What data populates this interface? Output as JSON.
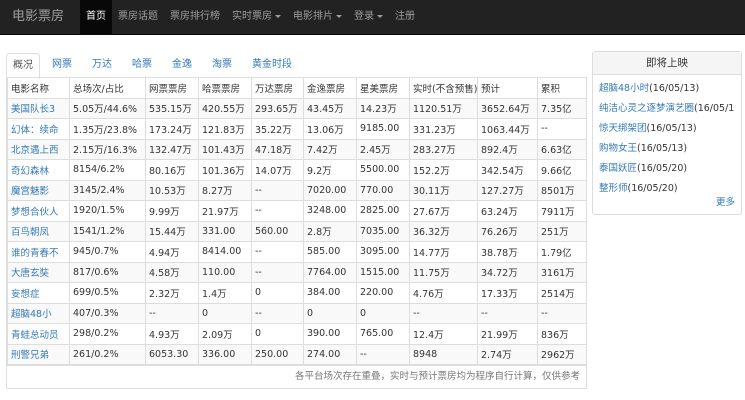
{
  "brand": "电影票房",
  "nav": [
    {
      "label": "首页",
      "active": true,
      "dropdown": false
    },
    {
      "label": "票房话题",
      "active": false,
      "dropdown": false
    },
    {
      "label": "票房排行榜",
      "active": false,
      "dropdown": false
    },
    {
      "label": "实时票房",
      "active": false,
      "dropdown": true
    },
    {
      "label": "电影排片",
      "active": false,
      "dropdown": true
    },
    {
      "label": "登录",
      "active": false,
      "dropdown": true
    },
    {
      "label": "注册",
      "active": false,
      "dropdown": false
    }
  ],
  "tabs": [
    "概况",
    "网票",
    "万达",
    "哈票",
    "金逸",
    "淘票",
    "黄金时段"
  ],
  "table": {
    "headers": [
      "电影名称",
      "总场次/占比",
      "网票票房",
      "哈票票房",
      "万达票房",
      "金逸票房",
      "星美票房",
      "实时(不含预售)",
      "预计",
      "累积"
    ],
    "rows": [
      [
        "美国队长3",
        "5.05万/44.6%",
        "535.15万",
        "420.55万",
        "293.65万",
        "43.45万",
        "14.23万",
        "1120.51万",
        "3652.64万",
        "7.35亿"
      ],
      [
        "幻体：续命",
        "1.35万/23.8%",
        "173.24万",
        "121.83万",
        "35.22万",
        "13.06万",
        "9185.00",
        "331.23万",
        "1063.44万",
        "--"
      ],
      [
        "北京遇上西",
        "2.15万/16.3%",
        "132.47万",
        "101.43万",
        "47.18万",
        "7.42万",
        "2.45万",
        "283.27万",
        "892.4万",
        "6.63亿"
      ],
      [
        "奇幻森林",
        "8154/6.2%",
        "80.16万",
        "101.36万",
        "14.07万",
        "9.2万",
        "5500.00",
        "152.2万",
        "342.54万",
        "9.66亿"
      ],
      [
        "魔宫魅影",
        "3145/2.4%",
        "10.53万",
        "8.27万",
        "--",
        "7020.00",
        "770.00",
        "30.11万",
        "127.27万",
        "8501万"
      ],
      [
        "梦想合伙人",
        "1920/1.5%",
        "9.99万",
        "21.97万",
        "--",
        "3248.00",
        "2825.00",
        "27.67万",
        "63.24万",
        "7911万"
      ],
      [
        "百鸟朝凤",
        "1541/1.2%",
        "15.44万",
        "331.00",
        "560.00",
        "2.8万",
        "7035.00",
        "36.32万",
        "76.26万",
        "251万"
      ],
      [
        "谁的青春不",
        "945/0.7%",
        "4.94万",
        "8414.00",
        "--",
        "585.00",
        "3095.00",
        "14.77万",
        "38.78万",
        "1.79亿"
      ],
      [
        "大唐玄奘",
        "817/0.6%",
        "4.58万",
        "110.00",
        "--",
        "7764.00",
        "1515.00",
        "11.75万",
        "34.72万",
        "3161万"
      ],
      [
        "妄想症",
        "699/0.5%",
        "2.32万",
        "1.4万",
        "0",
        "384.00",
        "220.00",
        "4.76万",
        "17.33万",
        "2514万"
      ],
      [
        "超脑48小",
        "407/0.3%",
        "--",
        "0",
        "--",
        "0",
        "0",
        "--",
        "--",
        "--"
      ],
      [
        "青蛙总动员",
        "298/0.2%",
        "4.93万",
        "2.09万",
        "0",
        "390.00",
        "765.00",
        "12.4万",
        "21.99万",
        "836万"
      ],
      [
        "刑警兄弟",
        "261/0.2%",
        "6053.30",
        "336.00",
        "250.00",
        "274.00",
        "--",
        "8948",
        "2.74万",
        "2962万"
      ]
    ],
    "footnote": "各平台场次存在重叠，实时与预计票房均为程序自行计算，仅供参考"
  },
  "upcoming": {
    "title": "即将上映",
    "items": [
      {
        "name": "超脑48小时",
        "date": "(16/05/13)"
      },
      {
        "name": "纯洁心灵之逐梦演艺圈",
        "date": "(16/05/13)"
      },
      {
        "name": "惊天绑架团",
        "date": "(16/05/13)"
      },
      {
        "name": "购物女王",
        "date": "(16/05/13)"
      },
      {
        "name": "泰国妖匠",
        "date": "(16/05/20)"
      },
      {
        "name": "整形师",
        "date": "(16/05/20)"
      }
    ],
    "more": "更多"
  }
}
